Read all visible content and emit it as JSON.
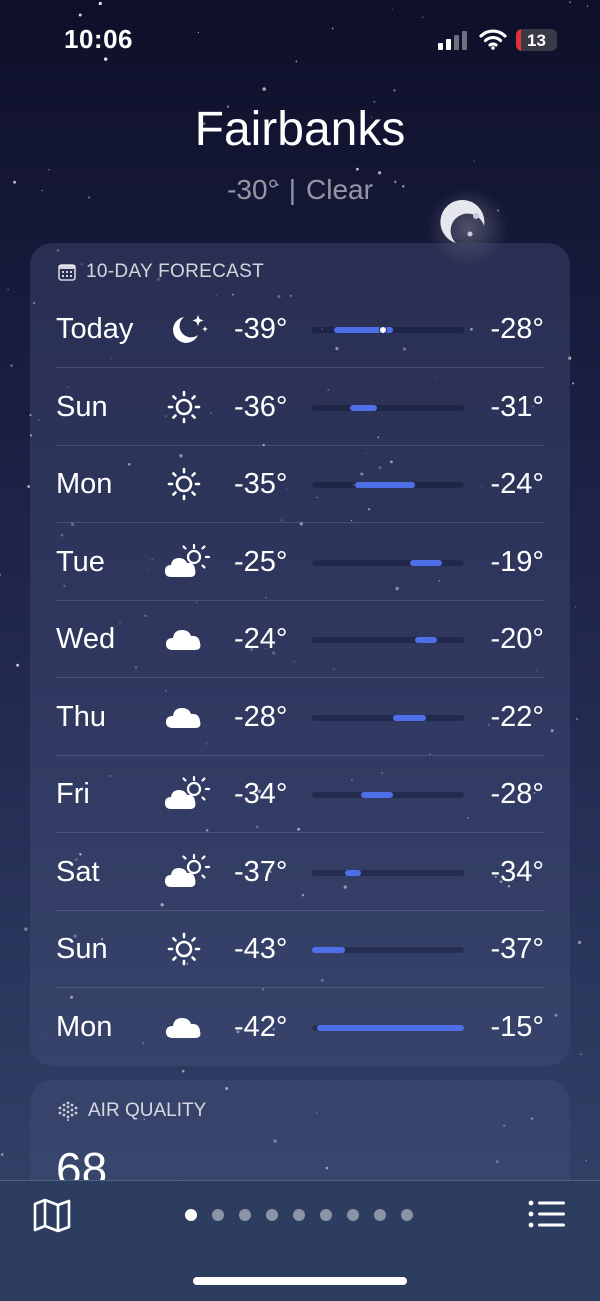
{
  "status_bar": {
    "time": "10:06",
    "battery": "13",
    "battery_level": 0.13
  },
  "header": {
    "city": "Fairbanks",
    "temperature": "-30°",
    "separator": "|",
    "condition": "Clear"
  },
  "forecast": {
    "title": "10-DAY FORECAST",
    "icon": "calendar-icon",
    "days": [
      {
        "day": "Today",
        "icon": "moon-stars-icon",
        "low": "-39°",
        "high": "-28°",
        "low_val": -39,
        "high_val": -28,
        "current": -30
      },
      {
        "day": "Sun",
        "icon": "sun-icon",
        "low": "-36°",
        "high": "-31°",
        "low_val": -36,
        "high_val": -31
      },
      {
        "day": "Mon",
        "icon": "sun-icon",
        "low": "-35°",
        "high": "-24°",
        "low_val": -35,
        "high_val": -24
      },
      {
        "day": "Tue",
        "icon": "partly-cloudy-icon",
        "low": "-25°",
        "high": "-19°",
        "low_val": -25,
        "high_val": -19
      },
      {
        "day": "Wed",
        "icon": "cloud-icon",
        "low": "-24°",
        "high": "-20°",
        "low_val": -24,
        "high_val": -20
      },
      {
        "day": "Thu",
        "icon": "cloud-icon",
        "low": "-28°",
        "high": "-22°",
        "low_val": -28,
        "high_val": -22
      },
      {
        "day": "Fri",
        "icon": "partly-cloudy-icon",
        "low": "-34°",
        "high": "-28°",
        "low_val": -34,
        "high_val": -28
      },
      {
        "day": "Sat",
        "icon": "partly-cloudy-icon",
        "low": "-37°",
        "high": "-34°",
        "low_val": -37,
        "high_val": -34
      },
      {
        "day": "Sun",
        "icon": "sun-icon",
        "low": "-43°",
        "high": "-37°",
        "low_val": -43,
        "high_val": -37
      },
      {
        "day": "Mon",
        "icon": "cloud-icon",
        "low": "-42°",
        "high": "-15°",
        "low_val": -42,
        "high_val": -15
      }
    ]
  },
  "air_quality": {
    "title": "AIR QUALITY",
    "icon": "air-quality-icon",
    "value": "68"
  },
  "bottom_bar": {
    "map_icon": "map-icon",
    "list_icon": "list-icon",
    "page_count": 9,
    "active_page": 0
  },
  "colors": {
    "bar": "#4f6fe8"
  }
}
